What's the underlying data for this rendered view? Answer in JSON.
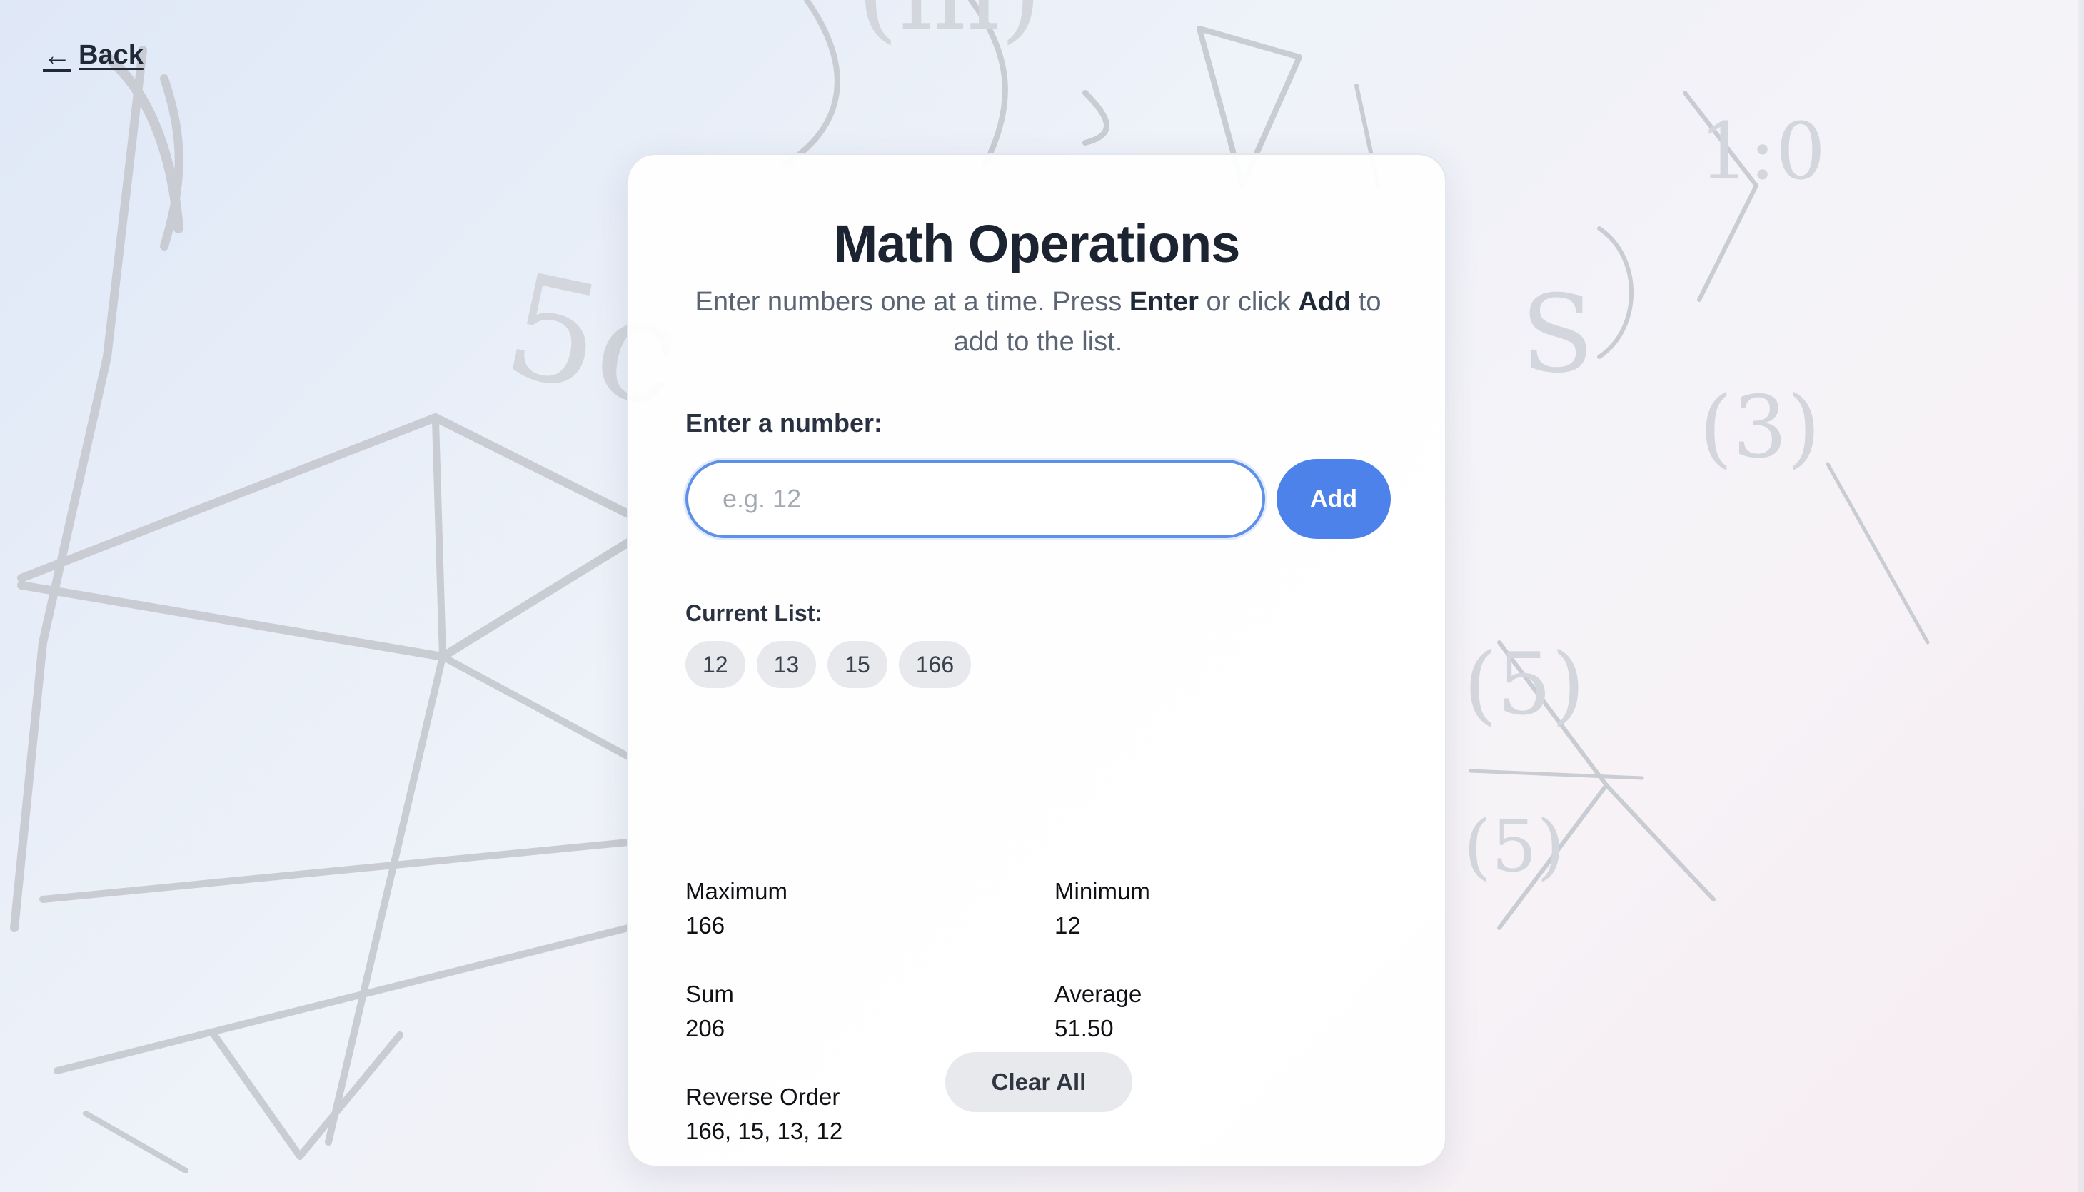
{
  "back": {
    "label": "Back",
    "icon": "arrow-left-icon"
  },
  "card": {
    "title": "Math Operations",
    "subtitle": {
      "part1": "Enter numbers one at a time. Press ",
      "enter_word": "Enter",
      "part2": " or click ",
      "add_word": "Add",
      "part3": " to add to the list."
    },
    "input": {
      "label": "Enter a number:",
      "placeholder": "e.g. 12",
      "value": ""
    },
    "add_button": "Add",
    "list": {
      "label": "Current List:",
      "items": [
        "12",
        "13",
        "15",
        "166"
      ]
    },
    "stats": {
      "maximum": {
        "label": "Maximum",
        "value": "166"
      },
      "minimum": {
        "label": "Minimum",
        "value": "12"
      },
      "sum": {
        "label": "Sum",
        "value": "206"
      },
      "average": {
        "label": "Average",
        "value": "51.50"
      },
      "reverse": {
        "label": "Reverse Order",
        "value": "166, 15, 13, 12"
      }
    },
    "clear_button": "Clear All"
  },
  "colors": {
    "accent": "#4d82ea",
    "input_border": "#5f90e8",
    "title": "#1c2432",
    "chip_bg": "#e7e9ed"
  }
}
